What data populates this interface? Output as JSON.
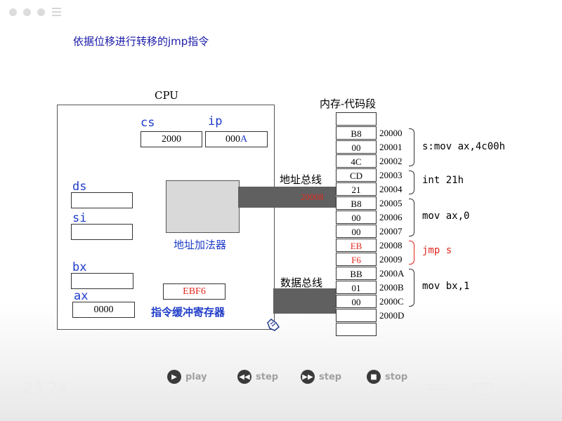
{
  "title": "依据位移进行转移的jmp指令",
  "cpu": {
    "label": "CPU",
    "cs_label": "cs",
    "cs_value": "2000",
    "ip_label": "ip",
    "ip_value_prefix": "000",
    "ip_value_suffix": "A",
    "ds_label": "ds",
    "si_label": "si",
    "bx_label": "bx",
    "ax_label": "ax",
    "ax_value": "0000",
    "adder_label": "地址加法器",
    "buffer_value": "EBF6",
    "buffer_label": "指令缓冲寄存器"
  },
  "bus": {
    "address_label": "地址总线",
    "address_value": "20008",
    "data_label": "数据总线"
  },
  "memory": {
    "title": "内存-代码段",
    "cells": [
      {
        "val": "",
        "addr": ""
      },
      {
        "val": "B8",
        "addr": "20000"
      },
      {
        "val": "00",
        "addr": "20001"
      },
      {
        "val": "4C",
        "addr": "20002"
      },
      {
        "val": "CD",
        "addr": "20003"
      },
      {
        "val": "21",
        "addr": "20004"
      },
      {
        "val": "B8",
        "addr": "20005"
      },
      {
        "val": "00",
        "addr": "20006"
      },
      {
        "val": "00",
        "addr": "20007"
      },
      {
        "val": "EB",
        "addr": "20008"
      },
      {
        "val": "F6",
        "addr": "20009"
      },
      {
        "val": "BB",
        "addr": "2000A"
      },
      {
        "val": "01",
        "addr": "2000B"
      },
      {
        "val": "00",
        "addr": "2000C"
      },
      {
        "val": "",
        "addr": "2000D"
      },
      {
        "val": "",
        "addr": ""
      }
    ],
    "notes": [
      "s:mov ax,4c00h",
      "int 21h",
      "mov ax,0",
      "jmp s",
      "mov bx,1"
    ]
  },
  "controls": {
    "play": "play",
    "step_back": "step",
    "step_forward": "step",
    "stop": "stop",
    "time": "23:24"
  },
  "colors": {
    "highlight": "#e0281e",
    "label_blue": "#1e3cc8"
  }
}
